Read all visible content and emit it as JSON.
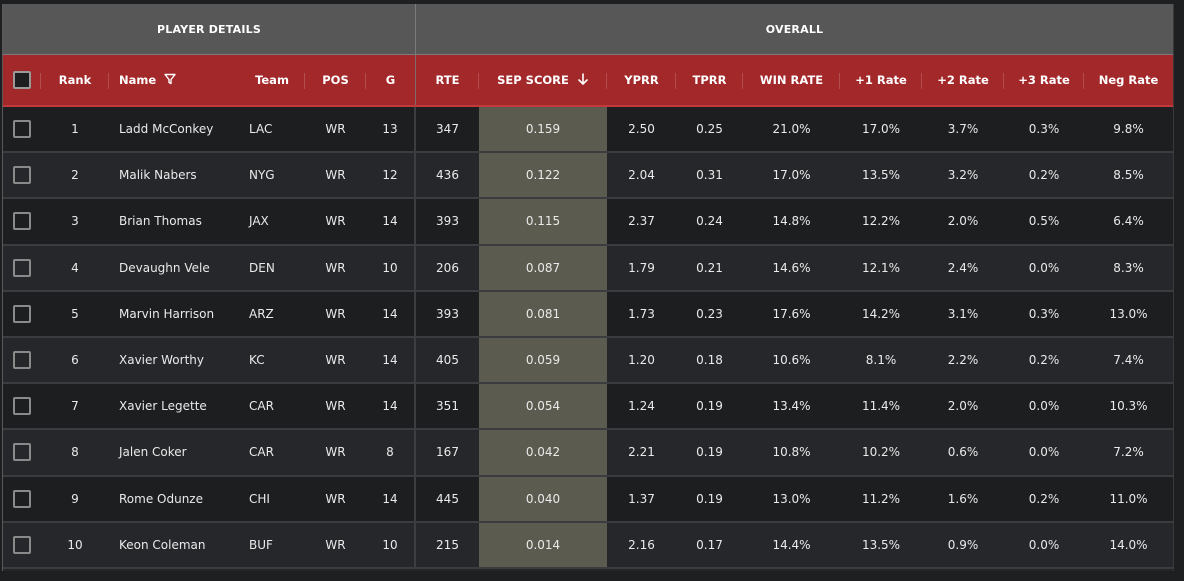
{
  "groups": {
    "details": "PLAYER DETAILS",
    "overall": "OVERALL"
  },
  "columns": {
    "rank": "Rank",
    "name": "Name",
    "team": "Team",
    "pos": "POS",
    "g": "G",
    "rte": "RTE",
    "sep": "SEP SCORE",
    "yprr": "YPRR",
    "tprr": "TPRR",
    "win": "WIN RATE",
    "p1": "+1 Rate",
    "p2": "+2 Rate",
    "p3": "+3 Rate",
    "neg": "Neg Rate"
  },
  "icons": {
    "filter": "filter-icon",
    "sort": "sort-descending-icon"
  },
  "colors": {
    "header_red": "#a3282a",
    "group_gray": "#575757",
    "highlight": "#5b5b4f"
  },
  "sort": {
    "column": "SEP SCORE",
    "direction": "descending"
  },
  "rows": [
    {
      "rank": "1",
      "name": "Ladd McConkey",
      "team": "LAC",
      "pos": "WR",
      "g": "13",
      "rte": "347",
      "sep": "0.159",
      "yprr": "2.50",
      "tprr": "0.25",
      "win": "21.0%",
      "p1": "17.0%",
      "p2": "3.7%",
      "p3": "0.3%",
      "neg": "9.8%"
    },
    {
      "rank": "2",
      "name": "Malik Nabers",
      "team": "NYG",
      "pos": "WR",
      "g": "12",
      "rte": "436",
      "sep": "0.122",
      "yprr": "2.04",
      "tprr": "0.31",
      "win": "17.0%",
      "p1": "13.5%",
      "p2": "3.2%",
      "p3": "0.2%",
      "neg": "8.5%"
    },
    {
      "rank": "3",
      "name": "Brian Thomas",
      "team": "JAX",
      "pos": "WR",
      "g": "14",
      "rte": "393",
      "sep": "0.115",
      "yprr": "2.37",
      "tprr": "0.24",
      "win": "14.8%",
      "p1": "12.2%",
      "p2": "2.0%",
      "p3": "0.5%",
      "neg": "6.4%"
    },
    {
      "rank": "4",
      "name": "Devaughn Vele",
      "team": "DEN",
      "pos": "WR",
      "g": "10",
      "rte": "206",
      "sep": "0.087",
      "yprr": "1.79",
      "tprr": "0.21",
      "win": "14.6%",
      "p1": "12.1%",
      "p2": "2.4%",
      "p3": "0.0%",
      "neg": "8.3%"
    },
    {
      "rank": "5",
      "name": "Marvin Harrison",
      "team": "ARZ",
      "pos": "WR",
      "g": "14",
      "rte": "393",
      "sep": "0.081",
      "yprr": "1.73",
      "tprr": "0.23",
      "win": "17.6%",
      "p1": "14.2%",
      "p2": "3.1%",
      "p3": "0.3%",
      "neg": "13.0%"
    },
    {
      "rank": "6",
      "name": "Xavier Worthy",
      "team": "KC",
      "pos": "WR",
      "g": "14",
      "rte": "405",
      "sep": "0.059",
      "yprr": "1.20",
      "tprr": "0.18",
      "win": "10.6%",
      "p1": "8.1%",
      "p2": "2.2%",
      "p3": "0.2%",
      "neg": "7.4%"
    },
    {
      "rank": "7",
      "name": "Xavier Legette",
      "team": "CAR",
      "pos": "WR",
      "g": "14",
      "rte": "351",
      "sep": "0.054",
      "yprr": "1.24",
      "tprr": "0.19",
      "win": "13.4%",
      "p1": "11.4%",
      "p2": "2.0%",
      "p3": "0.0%",
      "neg": "10.3%"
    },
    {
      "rank": "8",
      "name": "Jalen Coker",
      "team": "CAR",
      "pos": "WR",
      "g": "8",
      "rte": "167",
      "sep": "0.042",
      "yprr": "2.21",
      "tprr": "0.19",
      "win": "10.8%",
      "p1": "10.2%",
      "p2": "0.6%",
      "p3": "0.0%",
      "neg": "7.2%"
    },
    {
      "rank": "9",
      "name": "Rome Odunze",
      "team": "CHI",
      "pos": "WR",
      "g": "14",
      "rte": "445",
      "sep": "0.040",
      "yprr": "1.37",
      "tprr": "0.19",
      "win": "13.0%",
      "p1": "11.2%",
      "p2": "1.6%",
      "p3": "0.2%",
      "neg": "11.0%"
    },
    {
      "rank": "10",
      "name": "Keon Coleman",
      "team": "BUF",
      "pos": "WR",
      "g": "10",
      "rte": "215",
      "sep": "0.014",
      "yprr": "2.16",
      "tprr": "0.17",
      "win": "14.4%",
      "p1": "13.5%",
      "p2": "0.9%",
      "p3": "0.0%",
      "neg": "14.0%"
    }
  ]
}
